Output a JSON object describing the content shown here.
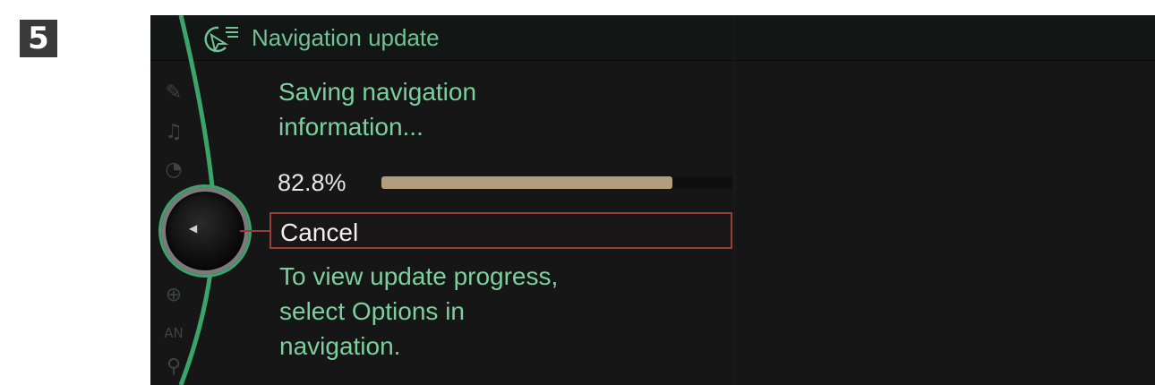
{
  "step_badge": "5",
  "header": {
    "title": "Navigation update",
    "icon": "navigation-update-icon"
  },
  "message": {
    "line1": "Saving navigation",
    "line2": "information..."
  },
  "progress": {
    "percent_label": "82.8%",
    "fraction": 0.828
  },
  "cancel": {
    "label": "Cancel"
  },
  "hint": {
    "line1": "To view update progress,",
    "line2": "select Options in",
    "line3": "navigation."
  },
  "side_icons": [
    "communication-icon",
    "audio-icon",
    "timer-icon",
    "controller-icon",
    "target-icon",
    "compass-icon",
    "search-icon"
  ],
  "colors": {
    "accent_green": "#6fc394",
    "text_green": "#7bd09d",
    "progress_fill": "#b29e7d",
    "focus_red": "#9a3d37",
    "arc_green": "#3aa46a"
  }
}
